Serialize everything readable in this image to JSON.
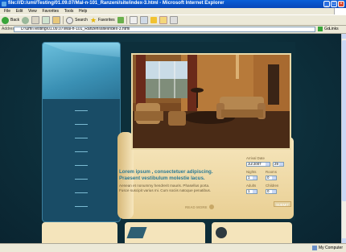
{
  "window": {
    "title": "file:///D:/uml/Testing/01.09.07/Mal-n-101_Ranzeni/site/index-3.html - Microsoft Internet Explorer",
    "close_label": "×",
    "max_label": "□",
    "min_label": "_"
  },
  "menu": [
    "File",
    "Edit",
    "View",
    "Favorites",
    "Tools",
    "Help"
  ],
  "toolbar": {
    "back_label": "Back",
    "search_label": "Search",
    "favorites_label": "Favorites"
  },
  "address": {
    "label": "Address",
    "value": "D:\\uml\\Testing\\01.09.07\\Mal-n-101_Ranzeni\\site\\index-3.html",
    "go_label": "Go",
    "links_label": "Links"
  },
  "status": {
    "zone_label": "My Computer"
  },
  "site": {
    "heading_1": "Lorem ipsum , consectetuer adipiscing.",
    "heading_2": "Praesent vestibulum molestie lacus.",
    "body": "Aenean et nonummy hendrerit mauris. Phasellus porta. Fusce suscipit varius mi. Cum sociis natoque penatibus.",
    "read_more": "READ MORE",
    "nav_items": [
      "—",
      "—",
      "—",
      "—",
      "—",
      "—",
      "—",
      "—"
    ],
    "booking": {
      "arrival_label": "Arrival Date",
      "month_value": "Jul 2007",
      "day_value": "29",
      "nights_label": "Nights",
      "rooms_label": "Rooms",
      "nights_value": "1",
      "rooms_value": "0",
      "adults_label": "Adults",
      "children_label": "Children",
      "adults_value": "1",
      "children_value": "0",
      "submit_label": "SUBMIT"
    }
  }
}
